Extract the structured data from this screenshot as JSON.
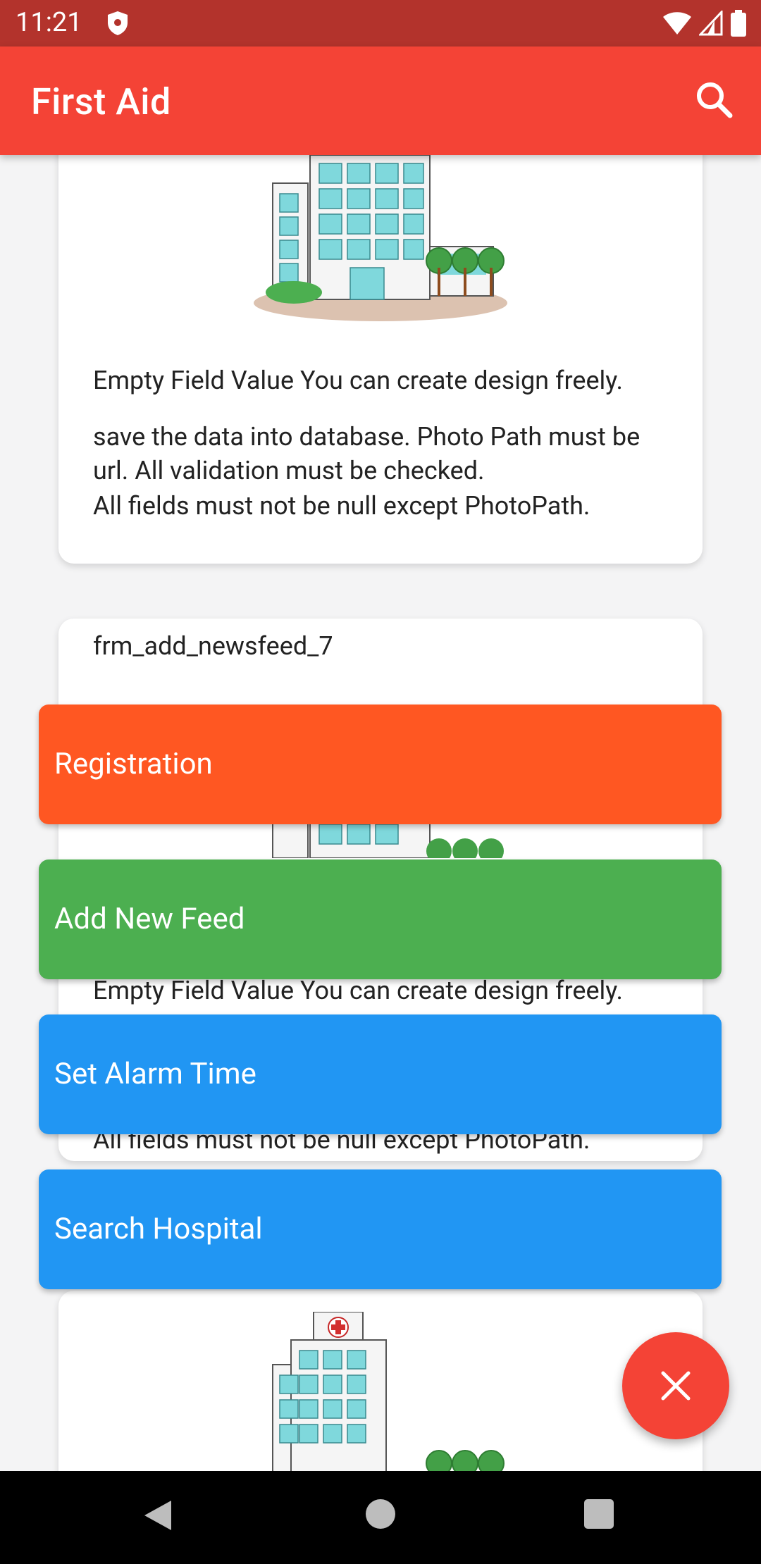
{
  "status_bar": {
    "time": "11:21",
    "icons": [
      "shield-icon",
      "wifi-icon",
      "signal-icon",
      "battery-icon"
    ]
  },
  "app_bar": {
    "title": "First Aid",
    "search_icon": "search-icon"
  },
  "feed": {
    "cards": [
      {
        "text": "Empty Field Value You can create design freely.",
        "body": [
          "save the data into database. Photo Path must be url. All validation must be checked.",
          "All fields must not be null except PhotoPath."
        ]
      },
      {
        "title": "frm_add_newsfeed_7",
        "text": "Empty Field Value You can create design freely.",
        "partial": "All fields must not be null except PhotoPath."
      },
      {}
    ]
  },
  "actions": [
    {
      "label": "Registration",
      "color": "#ff5722"
    },
    {
      "label": "Add New Feed",
      "color": "#4caf50"
    },
    {
      "label": "Set Alarm Time",
      "color": "#2196f3"
    },
    {
      "label": "Search Hospital",
      "color": "#2196f3"
    }
  ],
  "fab": {
    "icon": "close-icon",
    "color": "#f44336"
  },
  "nav_bar": {
    "icons": [
      "back-icon",
      "home-icon",
      "recents-icon"
    ]
  },
  "colors": {
    "app_bar": "#f44336",
    "status_bar": "#b3332c"
  }
}
